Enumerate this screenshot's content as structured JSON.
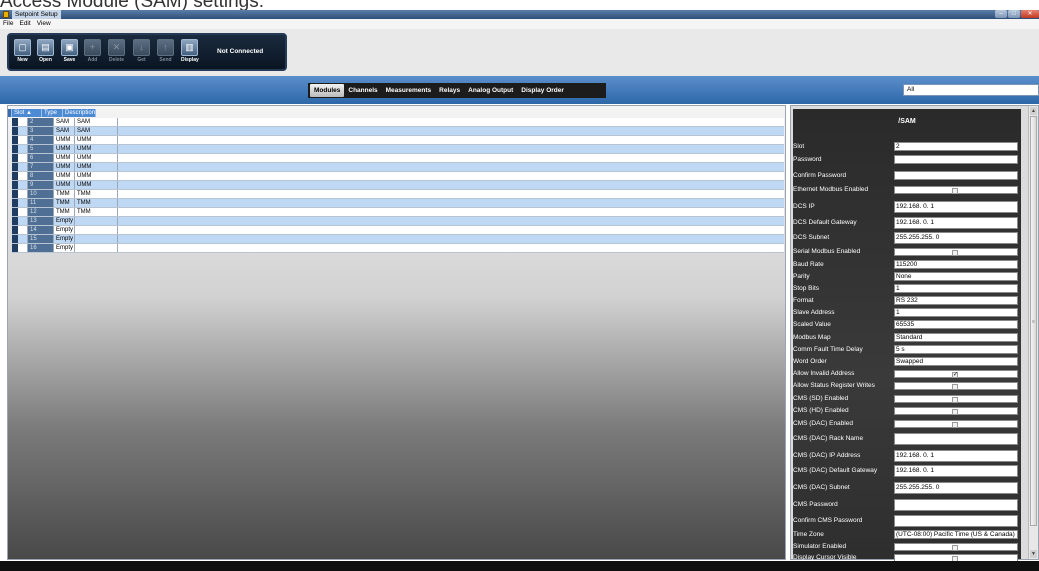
{
  "caption": "Access Module (SAM) settings:",
  "window": {
    "title": "Setpoint Setup",
    "minimize_glyph": "–",
    "maximize_glyph": "□",
    "close_glyph": "✕"
  },
  "menu": [
    "File",
    "Edit",
    "View"
  ],
  "toolbar": {
    "buttons": [
      {
        "label": "New",
        "icon": "new-file-icon",
        "glyph": "▢",
        "enabled": true
      },
      {
        "label": "Open",
        "icon": "folder-icon",
        "glyph": "▤",
        "enabled": true
      },
      {
        "label": "Save",
        "icon": "disk-icon",
        "glyph": "▣",
        "enabled": true
      },
      {
        "label": "Add",
        "icon": "add-icon",
        "glyph": "+",
        "enabled": false
      },
      {
        "label": "Delete",
        "icon": "delete-icon",
        "glyph": "✕",
        "enabled": false
      },
      {
        "label": "Get",
        "icon": "get-icon",
        "glyph": "↓",
        "enabled": false
      },
      {
        "label": "Send",
        "icon": "send-icon",
        "glyph": "↑",
        "enabled": false
      },
      {
        "label": "Display",
        "icon": "display-icon",
        "glyph": "▥",
        "enabled": true
      }
    ],
    "status": "Not Connected"
  },
  "tabs": [
    {
      "label": "Modules",
      "active": true
    },
    {
      "label": "Channels",
      "active": false
    },
    {
      "label": "Measurements",
      "active": false
    },
    {
      "label": "Relays",
      "active": false
    },
    {
      "label": "Analog Output",
      "active": false
    },
    {
      "label": "Display Order",
      "active": false
    }
  ],
  "filter": {
    "value": "All"
  },
  "grid": {
    "headers": [
      "Slot ▲",
      "Type",
      "Description"
    ],
    "rows": [
      {
        "slot": "2",
        "type": "SAM",
        "description": "SAM"
      },
      {
        "slot": "3",
        "type": "SAM",
        "description": "SAM"
      },
      {
        "slot": "4",
        "type": "UMM",
        "description": "UMM"
      },
      {
        "slot": "5",
        "type": "UMM",
        "description": "UMM"
      },
      {
        "slot": "6",
        "type": "UMM",
        "description": "UMM"
      },
      {
        "slot": "7",
        "type": "UMM",
        "description": "UMM"
      },
      {
        "slot": "8",
        "type": "UMM",
        "description": "UMM"
      },
      {
        "slot": "9",
        "type": "UMM",
        "description": "UMM"
      },
      {
        "slot": "10",
        "type": "TMM",
        "description": "TMM"
      },
      {
        "slot": "11",
        "type": "TMM",
        "description": "TMM"
      },
      {
        "slot": "12",
        "type": "TMM",
        "description": "TMM"
      },
      {
        "slot": "13",
        "type": "Empty",
        "description": ""
      },
      {
        "slot": "14",
        "type": "Empty",
        "description": ""
      },
      {
        "slot": "15",
        "type": "Empty",
        "description": ""
      },
      {
        "slot": "16",
        "type": "Empty",
        "description": ""
      }
    ]
  },
  "properties": {
    "title": "/SAM",
    "items": [
      {
        "label": "Slot",
        "value": "2",
        "kind": "text"
      },
      {
        "label": "Password",
        "value": "",
        "kind": "text"
      },
      {
        "label": "Confirm Password",
        "value": "",
        "kind": "text"
      },
      {
        "label": "Ethernet Modbus Enabled",
        "checked": false,
        "kind": "check"
      },
      {
        "label": "DCS IP",
        "value": "192.168.  0.  1",
        "kind": "text"
      },
      {
        "label": "DCS Default Gateway",
        "value": "192.168.  0.  1",
        "kind": "text"
      },
      {
        "label": "DCS Subnet",
        "value": "255.255.255.  0",
        "kind": "text"
      },
      {
        "label": "Serial Modbus Enabled",
        "checked": false,
        "kind": "check"
      },
      {
        "label": "Baud Rate",
        "value": "115200",
        "kind": "text"
      },
      {
        "label": "Parity",
        "value": "None",
        "kind": "text"
      },
      {
        "label": "Stop Bits",
        "value": "1",
        "kind": "text"
      },
      {
        "label": "Format",
        "value": "RS 232",
        "kind": "text"
      },
      {
        "label": "Slave Address",
        "value": "1",
        "kind": "text"
      },
      {
        "label": "Scaled Value",
        "value": "65535",
        "kind": "text"
      },
      {
        "label": "Modbus Map",
        "value": "Standard",
        "kind": "text"
      },
      {
        "label": "Comm Fault Time Delay",
        "value": "5 s",
        "kind": "text"
      },
      {
        "label": "Word Order",
        "value": "Swapped",
        "kind": "text"
      },
      {
        "label": "Allow Invalid Address",
        "checked": true,
        "kind": "check"
      },
      {
        "label": "Allow Status Register Writes",
        "checked": false,
        "kind": "check"
      },
      {
        "label": "CMS (SD) Enabled",
        "checked": false,
        "kind": "check"
      },
      {
        "label": "CMS (HD) Enabled",
        "checked": false,
        "kind": "check"
      },
      {
        "label": "CMS (DAC) Enabled",
        "checked": false,
        "kind": "check"
      },
      {
        "label": "CMS (DAC) Rack Name",
        "value": "",
        "kind": "text"
      },
      {
        "label": "CMS (DAC) IP Address",
        "value": "192.168.  0.  1",
        "kind": "text"
      },
      {
        "label": "CMS (DAC) Default Gateway",
        "value": "192.168.  0.  1",
        "kind": "text"
      },
      {
        "label": "CMS (DAC) Subnet",
        "value": "255.255.255.  0",
        "kind": "text"
      },
      {
        "label": "CMS Password",
        "value": "",
        "kind": "text"
      },
      {
        "label": "Confirm CMS Password",
        "value": "",
        "kind": "text"
      },
      {
        "label": "Time Zone",
        "value": "(UTC-08:00) Pacific Time (US & Canada)",
        "kind": "text"
      },
      {
        "label": "Simulator Enabled",
        "checked": false,
        "kind": "check"
      },
      {
        "label": "Display Cursor Visible",
        "checked": false,
        "kind": "check"
      }
    ]
  },
  "scrollbar": {
    "up": "▲",
    "down": "▼",
    "grip": "≡"
  },
  "colors": {
    "accent": "#3d7cc9",
    "selected_row": "#bfd8f3",
    "panel_bg": "#2a2a2a"
  }
}
